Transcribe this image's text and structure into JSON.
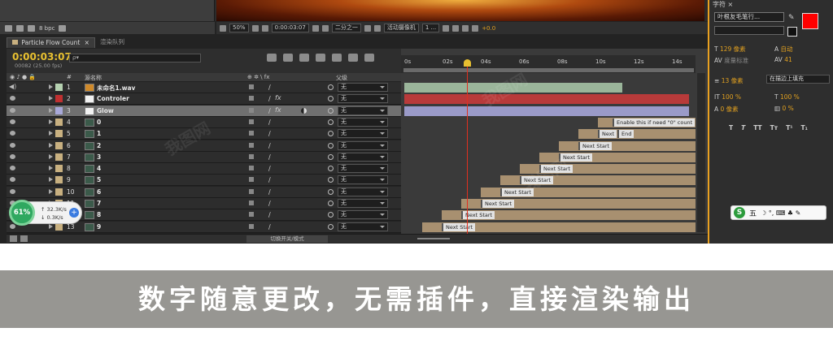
{
  "preview_toolbar": {
    "bit_depth": "8 bpc"
  },
  "viewer_controls": {
    "zoom": "50%",
    "timecode": "0:00:03:07",
    "resolution": "二分之一",
    "camera": "活动摄像机",
    "views": "1 ...",
    "exposure": "+0.0"
  },
  "tabs": [
    {
      "label": "Particle Flow Count",
      "close": "×"
    },
    {
      "label": "渲染队列"
    }
  ],
  "timeline": {
    "timecode": "0:00:03:07",
    "fps": "00082 (25.00 fps)",
    "search_prefix": "ρ▾"
  },
  "columns": {
    "num": "#",
    "source_name": "源名称",
    "switches": "⊕ ✲ \\ fx",
    "parent": "父级"
  },
  "layers": [
    {
      "num": "1",
      "name": "未命名1.wav",
      "label_color": "#b5d1b0",
      "parent": "无",
      "audio": true,
      "fx": false,
      "sel": false
    },
    {
      "num": "2",
      "name": "Controler",
      "label_color": "#c03030",
      "parent": "无",
      "audio": false,
      "fx": true,
      "sel": false
    },
    {
      "num": "3",
      "name": "Glow",
      "label_color": "#a8a8d8",
      "parent": "无",
      "audio": false,
      "fx": true,
      "sel": true
    },
    {
      "num": "4",
      "name": "0",
      "label_color": "#c8b080",
      "parent": "无",
      "audio": false,
      "fx": false,
      "sel": false
    },
    {
      "num": "5",
      "name": "1",
      "label_color": "#c8b080",
      "parent": "无",
      "audio": false,
      "fx": false,
      "sel": false
    },
    {
      "num": "6",
      "name": "2",
      "label_color": "#c8b080",
      "parent": "无",
      "audio": false,
      "fx": false,
      "sel": false
    },
    {
      "num": "7",
      "name": "3",
      "label_color": "#c8b080",
      "parent": "无",
      "audio": false,
      "fx": false,
      "sel": false
    },
    {
      "num": "8",
      "name": "4",
      "label_color": "#c8b080",
      "parent": "无",
      "audio": false,
      "fx": false,
      "sel": false
    },
    {
      "num": "9",
      "name": "5",
      "label_color": "#c8b080",
      "parent": "无",
      "audio": false,
      "fx": false,
      "sel": false
    },
    {
      "num": "10",
      "name": "6",
      "label_color": "#c8b080",
      "parent": "无",
      "audio": false,
      "fx": false,
      "sel": false
    },
    {
      "num": "11",
      "name": "7",
      "label_color": "#c8b080",
      "parent": "无",
      "audio": false,
      "fx": false,
      "sel": false
    },
    {
      "num": "12",
      "name": "8",
      "label_color": "#c8b080",
      "parent": "无",
      "audio": false,
      "fx": false,
      "sel": false
    },
    {
      "num": "13",
      "name": "9",
      "label_color": "#c8b080",
      "parent": "无",
      "audio": false,
      "fx": false,
      "sel": false
    }
  ],
  "ruler_ticks": [
    "0s",
    "02s",
    "04s",
    "06s",
    "08s",
    "10s",
    "12s",
    "14s"
  ],
  "markers": {
    "enable": "Enable this if need \"0\" count",
    "next": "Next",
    "end": "End",
    "next_start": "Next Start"
  },
  "footer": {
    "toggle_modes": "切换开关/模式"
  },
  "character_panel": {
    "tab": "字符 ×",
    "font_name": "叶根友毛笔行...",
    "font_size": "129 像素",
    "leading": "自动",
    "kerning": "度量标准",
    "tracking": "41",
    "stroke_width": "13 像素",
    "stroke_type": "在描边上填充",
    "vert_scale": "100 %",
    "horiz_scale": "100 %",
    "baseline_shift": "0 像素",
    "tsume": "0 %",
    "styles": [
      "T",
      "T",
      "TT",
      "Tᴛ",
      "T¹",
      "T₁"
    ],
    "fill_color": "#ff0000"
  },
  "ime_bar": {
    "logo": "S",
    "label": "五",
    "extra": "☽ °, ⌨ ♣ ✎"
  },
  "net_widget": {
    "percent": "61%",
    "up": "↑ 32.3K/s",
    "down": "↓ 0.3K/s"
  },
  "banner": {
    "text": "数字随意更改，无需插件，直接渲染输出"
  },
  "watermark": {
    "text": "我图网"
  }
}
